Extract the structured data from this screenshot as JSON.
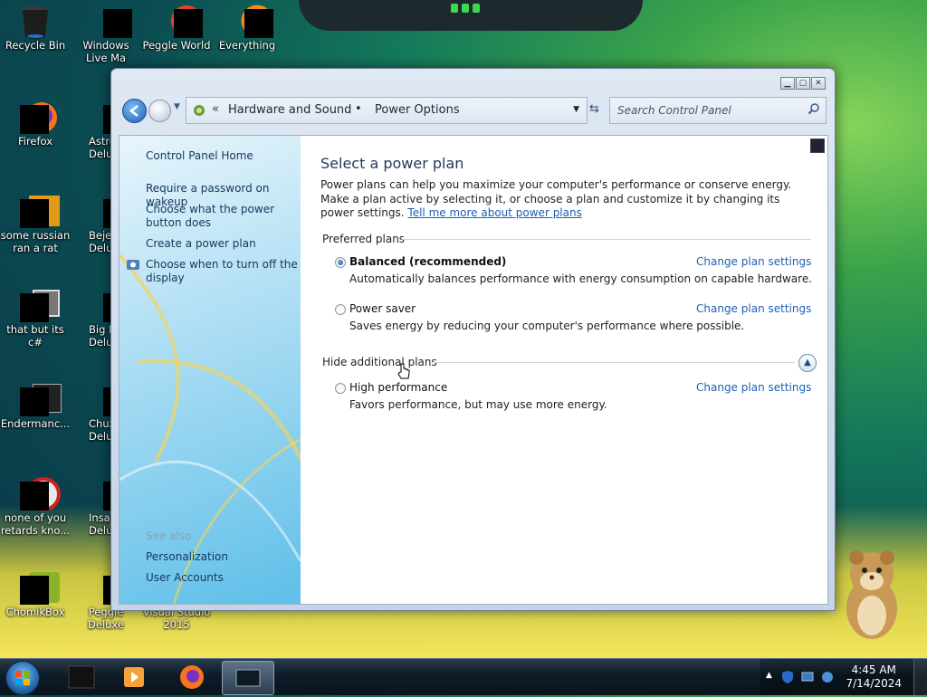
{
  "desktop": {
    "icons": [
      {
        "label": "Recycle Bin",
        "icon": "recycle-bin-icon"
      },
      {
        "label": "Windows Live Ma",
        "icon": "windows-live-icon"
      },
      {
        "label": "Peggle World",
        "icon": "peggle-world-icon"
      },
      {
        "label": "Everything",
        "icon": "everything-icon"
      },
      {
        "label": "Firefox",
        "icon": "firefox-icon"
      },
      {
        "label": "Astrol Delu",
        "icon": "astrol-icon"
      },
      {
        "label": "some russian ran a rat",
        "icon": "file-icon"
      },
      {
        "label": "Bejew Delu",
        "icon": "bejeweled-icon"
      },
      {
        "label": "that but its c#",
        "icon": "folder-icon"
      },
      {
        "label": "Big Mo Delu",
        "icon": "big-money-icon"
      },
      {
        "label": "Endermanc...",
        "icon": "app-icon"
      },
      {
        "label": "Chuz Delu",
        "icon": "chuzzle-icon"
      },
      {
        "label": "none of you retards kno...",
        "icon": "app-icon"
      },
      {
        "label": "Insaniq Delu",
        "icon": "insaniquarium-icon"
      },
      {
        "label": "ChomikBox",
        "icon": "chomikbox-icon"
      },
      {
        "label": "Peggle Deluxe",
        "icon": "peggle-deluxe-icon"
      },
      {
        "label": "Visual Studio 2015",
        "icon": "visual-studio-icon"
      }
    ]
  },
  "window": {
    "controls": {
      "minimize": "▁",
      "maximize": "▢",
      "close": "✕"
    },
    "nav": {
      "chevron": "«",
      "breadcrumb": [
        "Hardware and Sound",
        "Power Options"
      ],
      "separator": "•",
      "search_placeholder": "Search Control Panel"
    },
    "sidebar": {
      "items": [
        {
          "label": "Control Panel Home"
        },
        {
          "label": "Require a password on wakeup"
        },
        {
          "label": "Choose what the power button does"
        },
        {
          "label": "Create a power plan"
        },
        {
          "label": "Choose when to turn off the display"
        }
      ],
      "see_also_label": "See also",
      "see_also": [
        {
          "label": "Personalization"
        },
        {
          "label": "User Accounts"
        }
      ]
    },
    "main": {
      "title": "Select a power plan",
      "intro_text": "Power plans can help you maximize your computer's performance or conserve energy. Make a plan active by selecting it, or choose a plan and customize it by changing its power settings.",
      "intro_link": "Tell me more about power plans",
      "preferred_heading": "Preferred plans",
      "additional_heading": "Hide additional plans",
      "change_label": "Change plan settings",
      "plans": [
        {
          "name": "Balanced (recommended)",
          "description": "Automatically balances performance with energy consumption on capable hardware.",
          "selected": true
        },
        {
          "name": "Power saver",
          "description": "Saves energy by reducing your computer's performance where possible.",
          "selected": false
        },
        {
          "name": "High performance",
          "description": "Favors performance, but may use more energy.",
          "selected": false
        }
      ]
    }
  },
  "taskbar": {
    "time": "4:45 AM",
    "date": "7/14/2024"
  }
}
